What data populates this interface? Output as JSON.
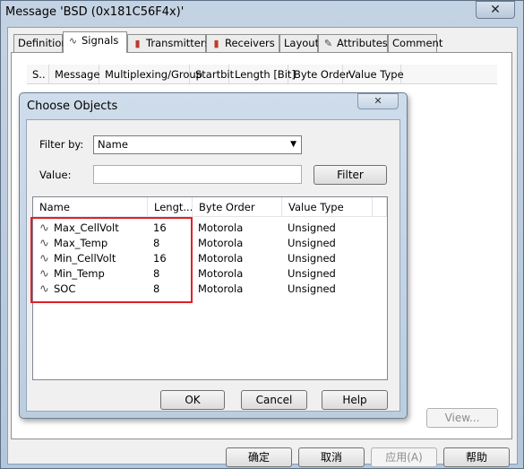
{
  "window": {
    "title": "Message 'BSD (0x181C56F4x)'",
    "close_glyph": "✕"
  },
  "tabs": [
    {
      "label": "Definition",
      "icon": ""
    },
    {
      "label": "Signals",
      "icon": "signal-icon"
    },
    {
      "label": "Transmitters",
      "icon": "transmitter-icon"
    },
    {
      "label": "Receivers",
      "icon": "receiver-icon"
    },
    {
      "label": "Layout",
      "icon": ""
    },
    {
      "label": "Attributes",
      "icon": "attributes-icon"
    },
    {
      "label": "Comment",
      "icon": ""
    }
  ],
  "signal_list_headers": [
    "S..",
    "Message",
    "Multiplexing/Group",
    "Startbit",
    "Length [Bit]",
    "Byte Order",
    "Value Type"
  ],
  "dialog": {
    "title": "Choose Objects",
    "close_glyph": "✕",
    "filter_by_label": "Filter by:",
    "filter_by_value": "Name",
    "value_label": "Value:",
    "value_input": "",
    "filter_button": "Filter",
    "columns": [
      "Name",
      "Lengt...",
      "Byte Order",
      "Value Type"
    ],
    "rows": [
      {
        "name": "Max_CellVolt",
        "length": "16",
        "byte_order": "Motorola",
        "value_type": "Unsigned"
      },
      {
        "name": "Max_Temp",
        "length": "8",
        "byte_order": "Motorola",
        "value_type": "Unsigned"
      },
      {
        "name": "Min_CellVolt",
        "length": "16",
        "byte_order": "Motorola",
        "value_type": "Unsigned"
      },
      {
        "name": "Min_Temp",
        "length": "8",
        "byte_order": "Motorola",
        "value_type": "Unsigned"
      },
      {
        "name": "SOC",
        "length": "8",
        "byte_order": "Motorola",
        "value_type": "Unsigned"
      }
    ],
    "ok_button": "OK",
    "cancel_button": "Cancel",
    "help_button": "Help"
  },
  "view_button": "View...",
  "footer": {
    "ok": "确定",
    "cancel": "取消",
    "apply": "应用(A)",
    "help": "帮助"
  },
  "colors": {
    "highlight": "#e0202a",
    "titlebar": "#c4d3e3"
  }
}
